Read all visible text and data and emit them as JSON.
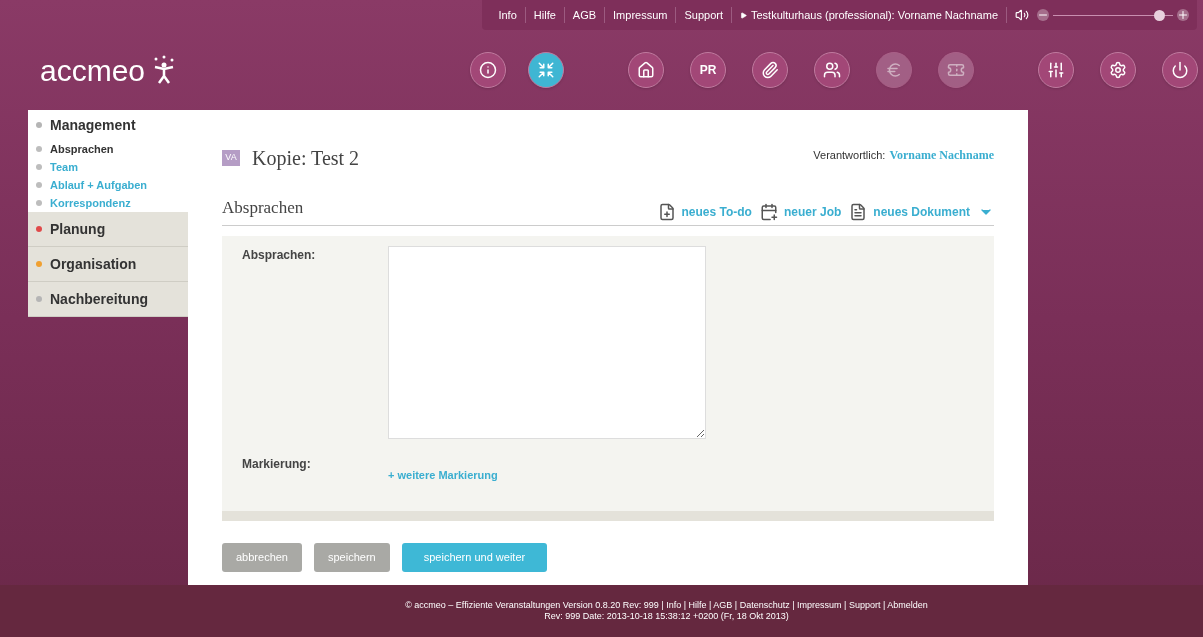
{
  "top_bar": {
    "links": [
      "Info",
      "Hilfe",
      "AGB",
      "Impressum",
      "Support"
    ],
    "account": "Testkulturhaus (professional): Vorname Nachname",
    "volume": {
      "level": 0.93
    }
  },
  "logo": "accmeo",
  "toolbar": [
    {
      "kind": "info",
      "selected": false,
      "disabled": false
    },
    {
      "kind": "focus",
      "selected": true,
      "disabled": false
    },
    {
      "kind": "home",
      "selected": false,
      "disabled": false
    },
    {
      "kind": "pr",
      "label": "PR",
      "selected": false,
      "disabled": false
    },
    {
      "kind": "clip",
      "selected": false,
      "disabled": false
    },
    {
      "kind": "people",
      "selected": false,
      "disabled": false
    },
    {
      "kind": "euro",
      "selected": false,
      "disabled": true
    },
    {
      "kind": "tickets",
      "selected": false,
      "disabled": true
    },
    {
      "kind": "sliders",
      "selected": false,
      "disabled": false
    },
    {
      "kind": "settings",
      "selected": false,
      "disabled": false
    },
    {
      "kind": "power",
      "selected": false,
      "disabled": false
    }
  ],
  "sidebar": [
    {
      "label": "Management",
      "color": "#b5b5b5",
      "expanded": true,
      "children": [
        {
          "label": "Absprachen",
          "selected": true
        },
        {
          "label": "Team",
          "selected": false
        },
        {
          "label": "Ablauf + Aufgaben",
          "selected": false
        },
        {
          "label": "Korrespondenz",
          "selected": false
        }
      ]
    },
    {
      "label": "Planung",
      "color": "#e04a4a",
      "expanded": false
    },
    {
      "label": "Organisation",
      "color": "#f0a030",
      "expanded": false
    },
    {
      "label": "Nachbereitung",
      "color": "#b5b5b5",
      "expanded": false
    }
  ],
  "page": {
    "badge": "VA",
    "title": "Kopie: Test 2",
    "responsible_label": "Verantwortlich:",
    "responsible_name": "Vorname Nachname"
  },
  "section": {
    "title": "Absprachen",
    "actions": [
      {
        "kind": "todo",
        "label": "neues To-do"
      },
      {
        "kind": "job",
        "label": "neuer Job"
      },
      {
        "kind": "document",
        "label": "neues Dokument"
      }
    ]
  },
  "form": [
    {
      "kind": "textarea",
      "label": "Absprachen:"
    },
    {
      "kind": "link",
      "label": "Markierung:",
      "link": "+ weitere Markierung"
    }
  ],
  "buttons": [
    {
      "kind": "secondary",
      "label": "abbrechen"
    },
    {
      "kind": "secondary",
      "label": "speichern"
    },
    {
      "kind": "primary",
      "label": "speichern und weiter"
    }
  ],
  "footer": [
    "© accmeo – Effiziente Veranstaltungen Version 0.8.20 Rev: 999 | Info | Hilfe | AGB | Datenschutz | Impressum | Support | Abmelden",
    "Rev: 999 Date: 2013-10-18 15:38:12 +0200 (Fr, 18 Okt 2013)"
  ]
}
